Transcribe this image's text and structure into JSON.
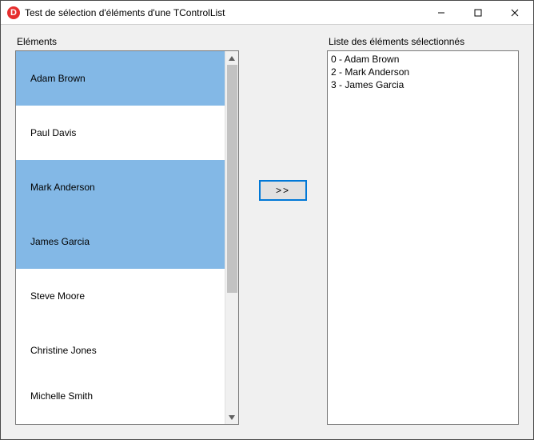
{
  "window": {
    "title": "Test de sélection d'éléments d'une TControlList",
    "appicon_letter": "D"
  },
  "left": {
    "label": "Eléments",
    "items": [
      {
        "name": "Adam Brown",
        "selected": true
      },
      {
        "name": "Paul Davis",
        "selected": false
      },
      {
        "name": "Mark Anderson",
        "selected": true
      },
      {
        "name": "James Garcia",
        "selected": true
      },
      {
        "name": "Steve Moore",
        "selected": false
      },
      {
        "name": "Christine Jones",
        "selected": false
      },
      {
        "name": "Michelle Smith",
        "selected": false
      }
    ]
  },
  "transfer": {
    "button_label": ">>"
  },
  "right": {
    "label": "Liste des éléments sélectionnés",
    "lines": [
      "0 - Adam Brown",
      "2 - Mark Anderson",
      "3 - James Garcia"
    ]
  }
}
